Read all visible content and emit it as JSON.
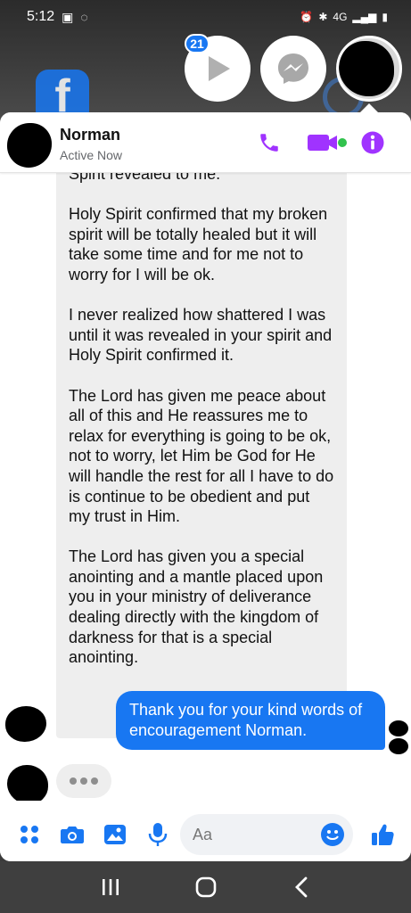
{
  "status_bar": {
    "time": "5:12",
    "network": "4G"
  },
  "chat_heads": {
    "unread_badge": "21",
    "icons": [
      "play-icon",
      "messenger-icon",
      "avatar"
    ]
  },
  "header": {
    "contact_name": "Norman",
    "presence": "Active Now",
    "icons": [
      "phone-icon",
      "video-icon",
      "info-icon"
    ],
    "accent_color": "#a033ff"
  },
  "messages": {
    "incoming": {
      "paragraphs": [
        "Spirit revealed to me.",
        "Holy Spirit confirmed that my broken spirit will be totally healed but it will take some time and for me not to worry for I will be ok.",
        "I never realized how shattered I was until it was revealed in your spirit and Holy Spirit confirmed it.",
        "The Lord has given me peace about all of this and He reassures me to relax for everything is going to be ok, not to worry, let Him be God for He will handle the rest for all I have to do is continue to be obedient and put my trust in Him.",
        "The Lord has given you a special anointing and a mantle placed upon you in your ministry of deliverance dealing directly with the kingdom of darkness for that is a special anointing."
      ]
    },
    "outgoing": {
      "text": "Thank you for your kind words of encouragement Norman.",
      "bubble_color": "#1877f2"
    },
    "typing_indicator": true
  },
  "composer": {
    "placeholder": "Aa",
    "icons": [
      "apps-icon",
      "camera-icon",
      "gallery-icon",
      "microphone-icon",
      "emoji-icon",
      "thumbs-up-icon"
    ]
  },
  "navbar": {
    "icons": [
      "recent-apps-icon",
      "home-icon",
      "back-icon"
    ]
  }
}
